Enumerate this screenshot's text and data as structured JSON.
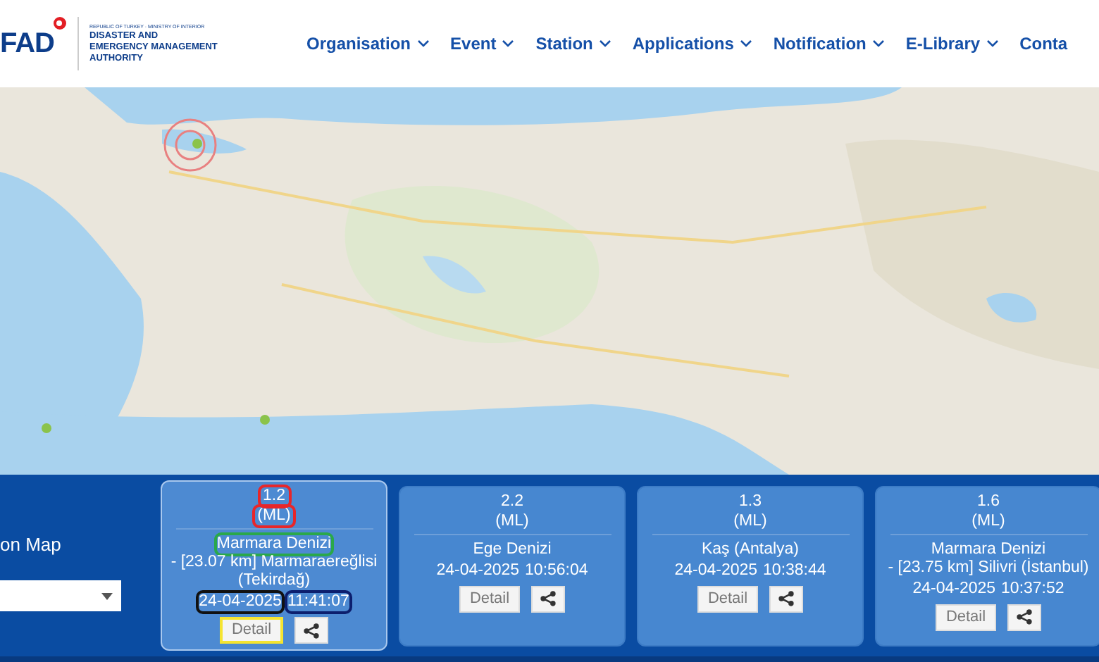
{
  "header": {
    "logo_text": "FAD",
    "org_small": "REPUBLIC OF TURKEY · MINISTRY OF INTERIOR",
    "org_name": "DISASTER AND EMERGENCY MANAGEMENT AUTHORITY",
    "nav": [
      {
        "label": "Organisation",
        "dropdown": true
      },
      {
        "label": "Event",
        "dropdown": true
      },
      {
        "label": "Station",
        "dropdown": true
      },
      {
        "label": "Applications",
        "dropdown": true
      },
      {
        "label": "Notification",
        "dropdown": true
      },
      {
        "label": "E-Library",
        "dropdown": true
      },
      {
        "label": "Conta",
        "dropdown": false
      }
    ]
  },
  "side_panel": {
    "label": "on Map"
  },
  "events": [
    {
      "magnitude": {
        "text": "1.2",
        "color": "#e8262a"
      },
      "scale": {
        "text": "(ML)",
        "color": "#e8262a"
      },
      "location": [
        {
          "text": "Marmara Denizi",
          "color": "#2aa84a"
        },
        {
          "text": "- [23.07 km] Marmaraereğlisi (Tekirdağ)"
        }
      ],
      "date": {
        "text": "24-04-2025",
        "color": "#111111"
      },
      "time": {
        "text": "11:41:07",
        "color": "#0c1f6e"
      },
      "detail": {
        "label": "Detail",
        "color": "#f5e431"
      },
      "selected": true
    },
    {
      "magnitude": {
        "text": "2.2"
      },
      "scale": {
        "text": "(ML)"
      },
      "location": [
        {
          "text": "Ege Denizi"
        }
      ],
      "date": {
        "text": "24-04-2025"
      },
      "time": {
        "text": "10:56:04"
      },
      "detail": {
        "label": "Detail"
      },
      "selected": false
    },
    {
      "magnitude": {
        "text": "1.3"
      },
      "scale": {
        "text": "(ML)"
      },
      "location": [
        {
          "text": "Kaş (Antalya)"
        }
      ],
      "date": {
        "text": "24-04-2025"
      },
      "time": {
        "text": "10:38:44"
      },
      "detail": {
        "label": "Detail"
      },
      "selected": false
    },
    {
      "magnitude": {
        "text": "1.6"
      },
      "scale": {
        "text": "(ML)"
      },
      "location": [
        {
          "text": "Marmara Denizi"
        },
        {
          "text": "- [23.75 km] Silivri (İstanbul)"
        }
      ],
      "date": {
        "text": "24-04-2025"
      },
      "time": {
        "text": "10:37:52"
      },
      "detail": {
        "label": "Detail"
      },
      "selected": false
    }
  ]
}
